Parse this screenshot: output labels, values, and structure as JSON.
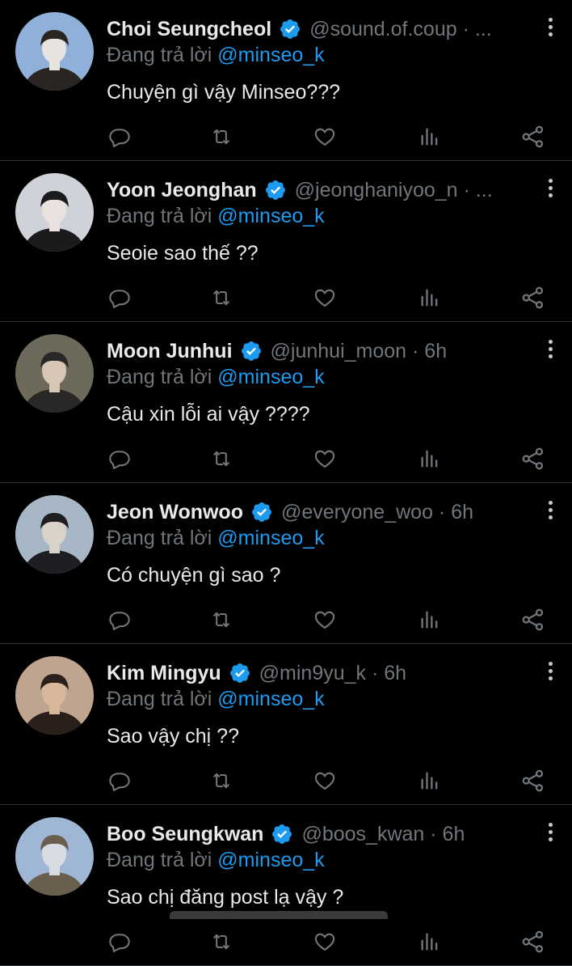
{
  "accent": "#1d9bf0",
  "background": "#000000",
  "replies": [
    {
      "name": "Choi Seungcheol",
      "handle": "@sound.of.coup · ...",
      "replying_label": "Đang trả lời",
      "mention": "@minseo_k",
      "text": "Chuyện gì vậy Minseo???",
      "avatar_colors": [
        "#8fb0d8",
        "#e8e3df",
        "#2b2522"
      ]
    },
    {
      "name": "Yoon Jeonghan",
      "handle": "@jeonghaniyoo_n · ...",
      "replying_label": "Đang trả lời",
      "mention": "@minseo_k",
      "text": "Seoie sao thế ??",
      "avatar_colors": [
        "#cfd2d8",
        "#e9e2de",
        "#1b1a1c"
      ]
    },
    {
      "name": "Moon Junhui",
      "handle": "@junhui_moon · 6h",
      "replying_label": "Đang trả lời",
      "mention": "@minseo_k",
      "text": "Cậu xin lỗi ai vậy ????",
      "avatar_colors": [
        "#6d6a5c",
        "#d8c7b6",
        "#2a2826"
      ]
    },
    {
      "name": "Jeon Wonwoo",
      "handle": "@everyone_woo · 6h",
      "replying_label": "Đang trả lời",
      "mention": "@minseo_k",
      "text": "Có chuyện gì sao ?",
      "avatar_colors": [
        "#a8b7c6",
        "#d9d2c9",
        "#1e1e22"
      ]
    },
    {
      "name": "Kim Mingyu",
      "handle": "@min9yu_k · 6h",
      "replying_label": "Đang trả lời",
      "mention": "@minseo_k",
      "text": "Sao vậy chị ??",
      "avatar_colors": [
        "#bfa58f",
        "#d9b79a",
        "#2a1f1a"
      ]
    },
    {
      "name": "Boo Seungkwan",
      "handle": "@boos_kwan · 6h",
      "replying_label": "Đang trả lời",
      "mention": "@minseo_k",
      "text": "Sao chị đăng post lạ vậy ?",
      "avatar_colors": [
        "#9fb6d4",
        "#d8dde4",
        "#6a5e4e"
      ]
    }
  ]
}
